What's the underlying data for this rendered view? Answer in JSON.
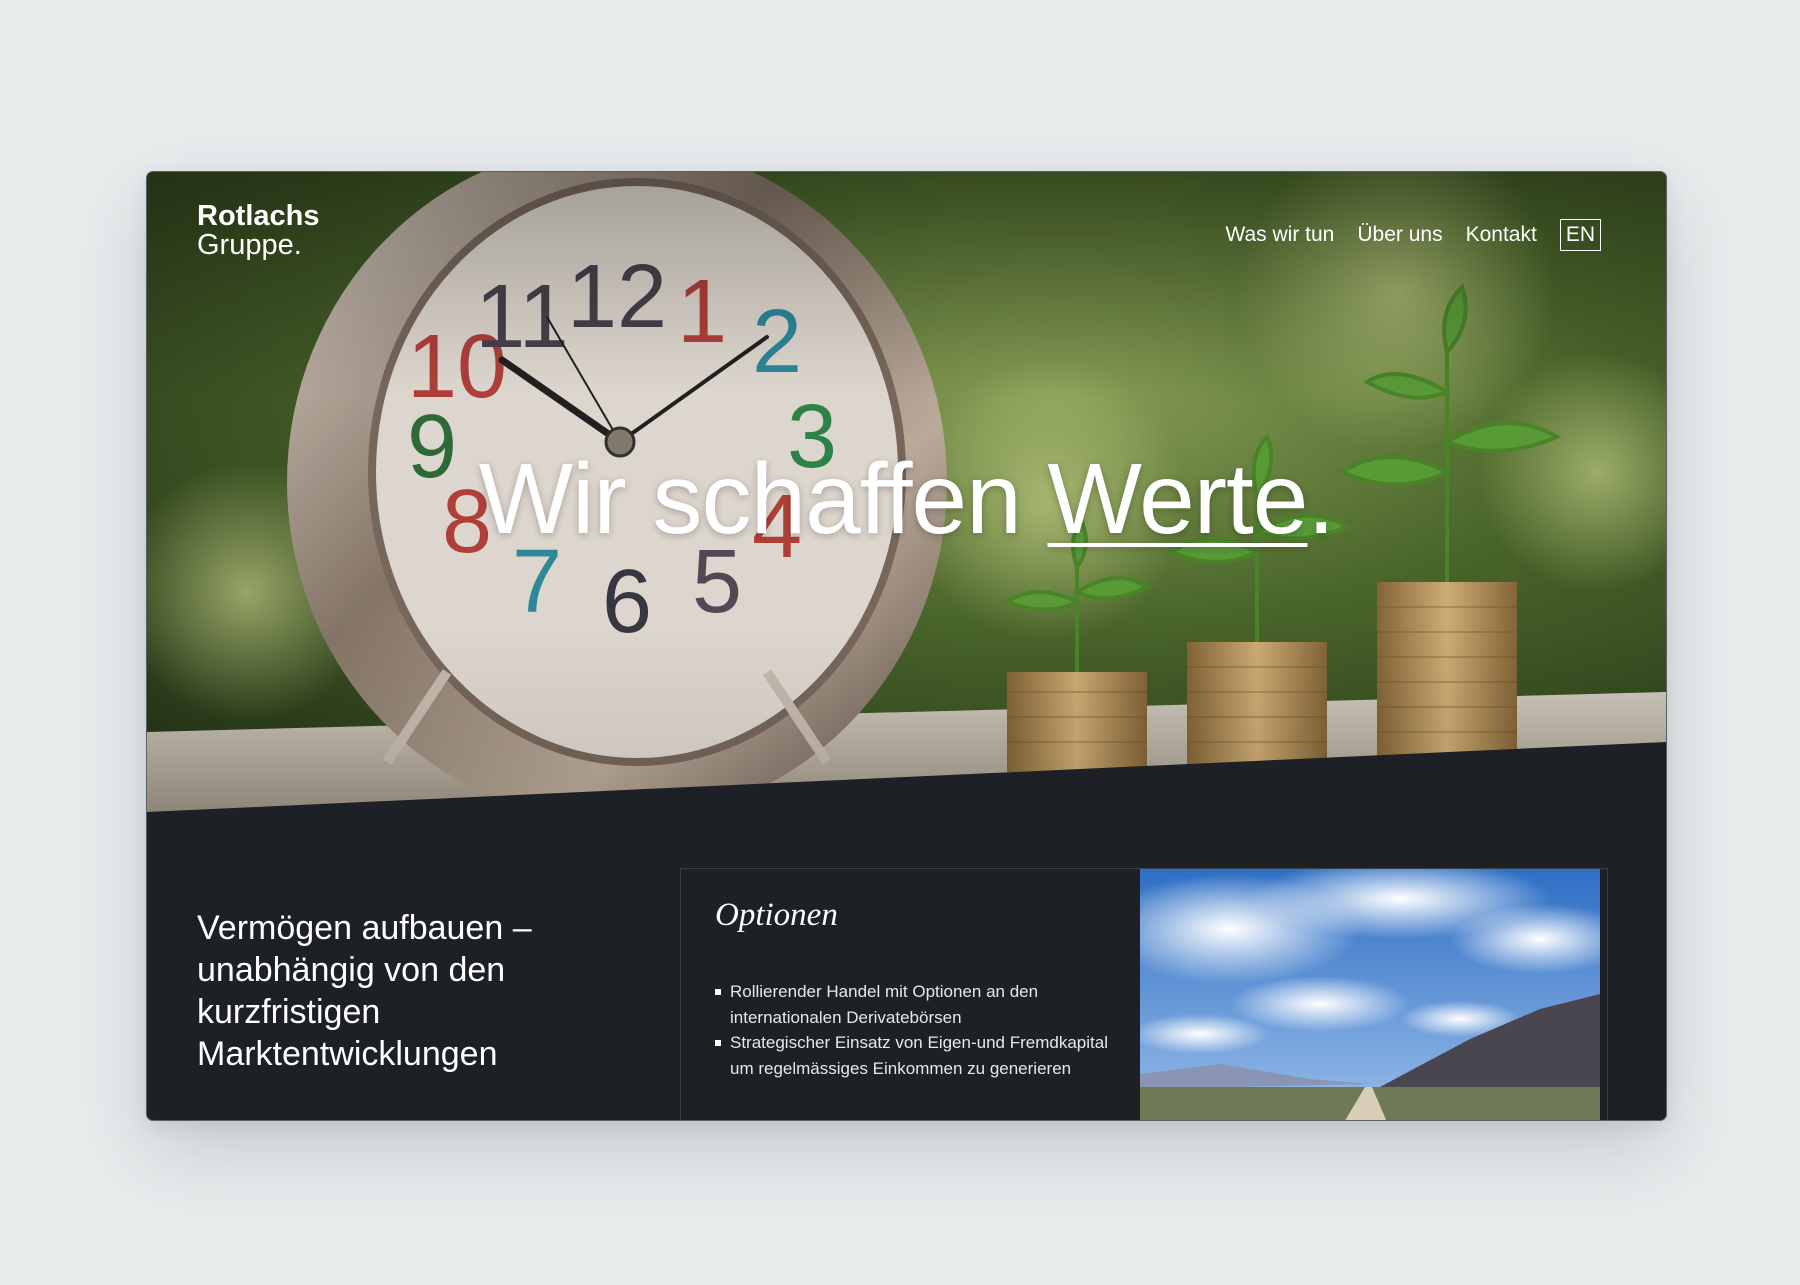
{
  "logo": {
    "line1": "Rotlachs",
    "line2": "Gruppe."
  },
  "nav": {
    "items": [
      {
        "label": "Was wir tun"
      },
      {
        "label": "Über uns"
      },
      {
        "label": "Kontakt"
      }
    ],
    "lang": "EN"
  },
  "hero": {
    "headline_prefix": "Wir schaffen ",
    "headline_highlight": "Werte",
    "headline_suffix": ".",
    "image": "alarm clock and growing plants on coin stacks"
  },
  "tagline": "Vermögen aufbauen – unabhängig von den kurzfristigen Marktentwicklungen",
  "card": {
    "title": "Optionen",
    "items": [
      "Rollierender Handel mit Optionen an den internationalen Derivatebörsen",
      "Strategischer Einsatz von Eigen-und Fremdkapital um regelmässiges Einkommen zu generieren"
    ],
    "image": "desert road with mountains and clouds"
  },
  "colors": {
    "page_bg": "#e9eced",
    "panel_bg": "#1d2024",
    "text": "#ffffff"
  }
}
